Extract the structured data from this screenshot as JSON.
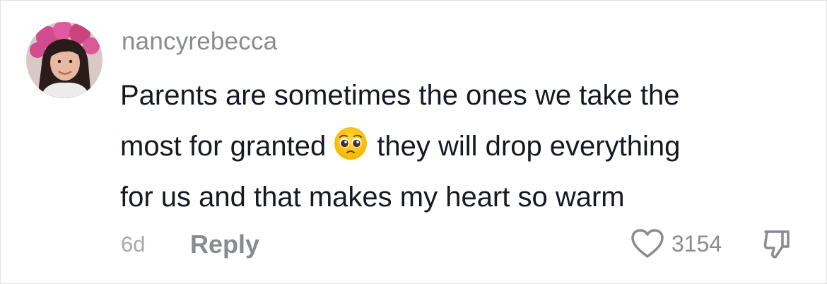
{
  "comment": {
    "username": "nancyrebecca",
    "text_lines": [
      "Parents are sometimes the ones we take the",
      "most for granted",
      "they will drop everything",
      "for us and that makes my heart so warm"
    ],
    "emoji": "pleading-face-emoji",
    "time_ago": "6d",
    "reply_label": "Reply",
    "like_count": "3154"
  },
  "icons": {
    "like": "heart-outline-icon",
    "dislike": "thumbs-down-outline-icon"
  },
  "colors": {
    "username": "#8a8b91",
    "text": "#161823",
    "meta": "#a7a8ad"
  }
}
